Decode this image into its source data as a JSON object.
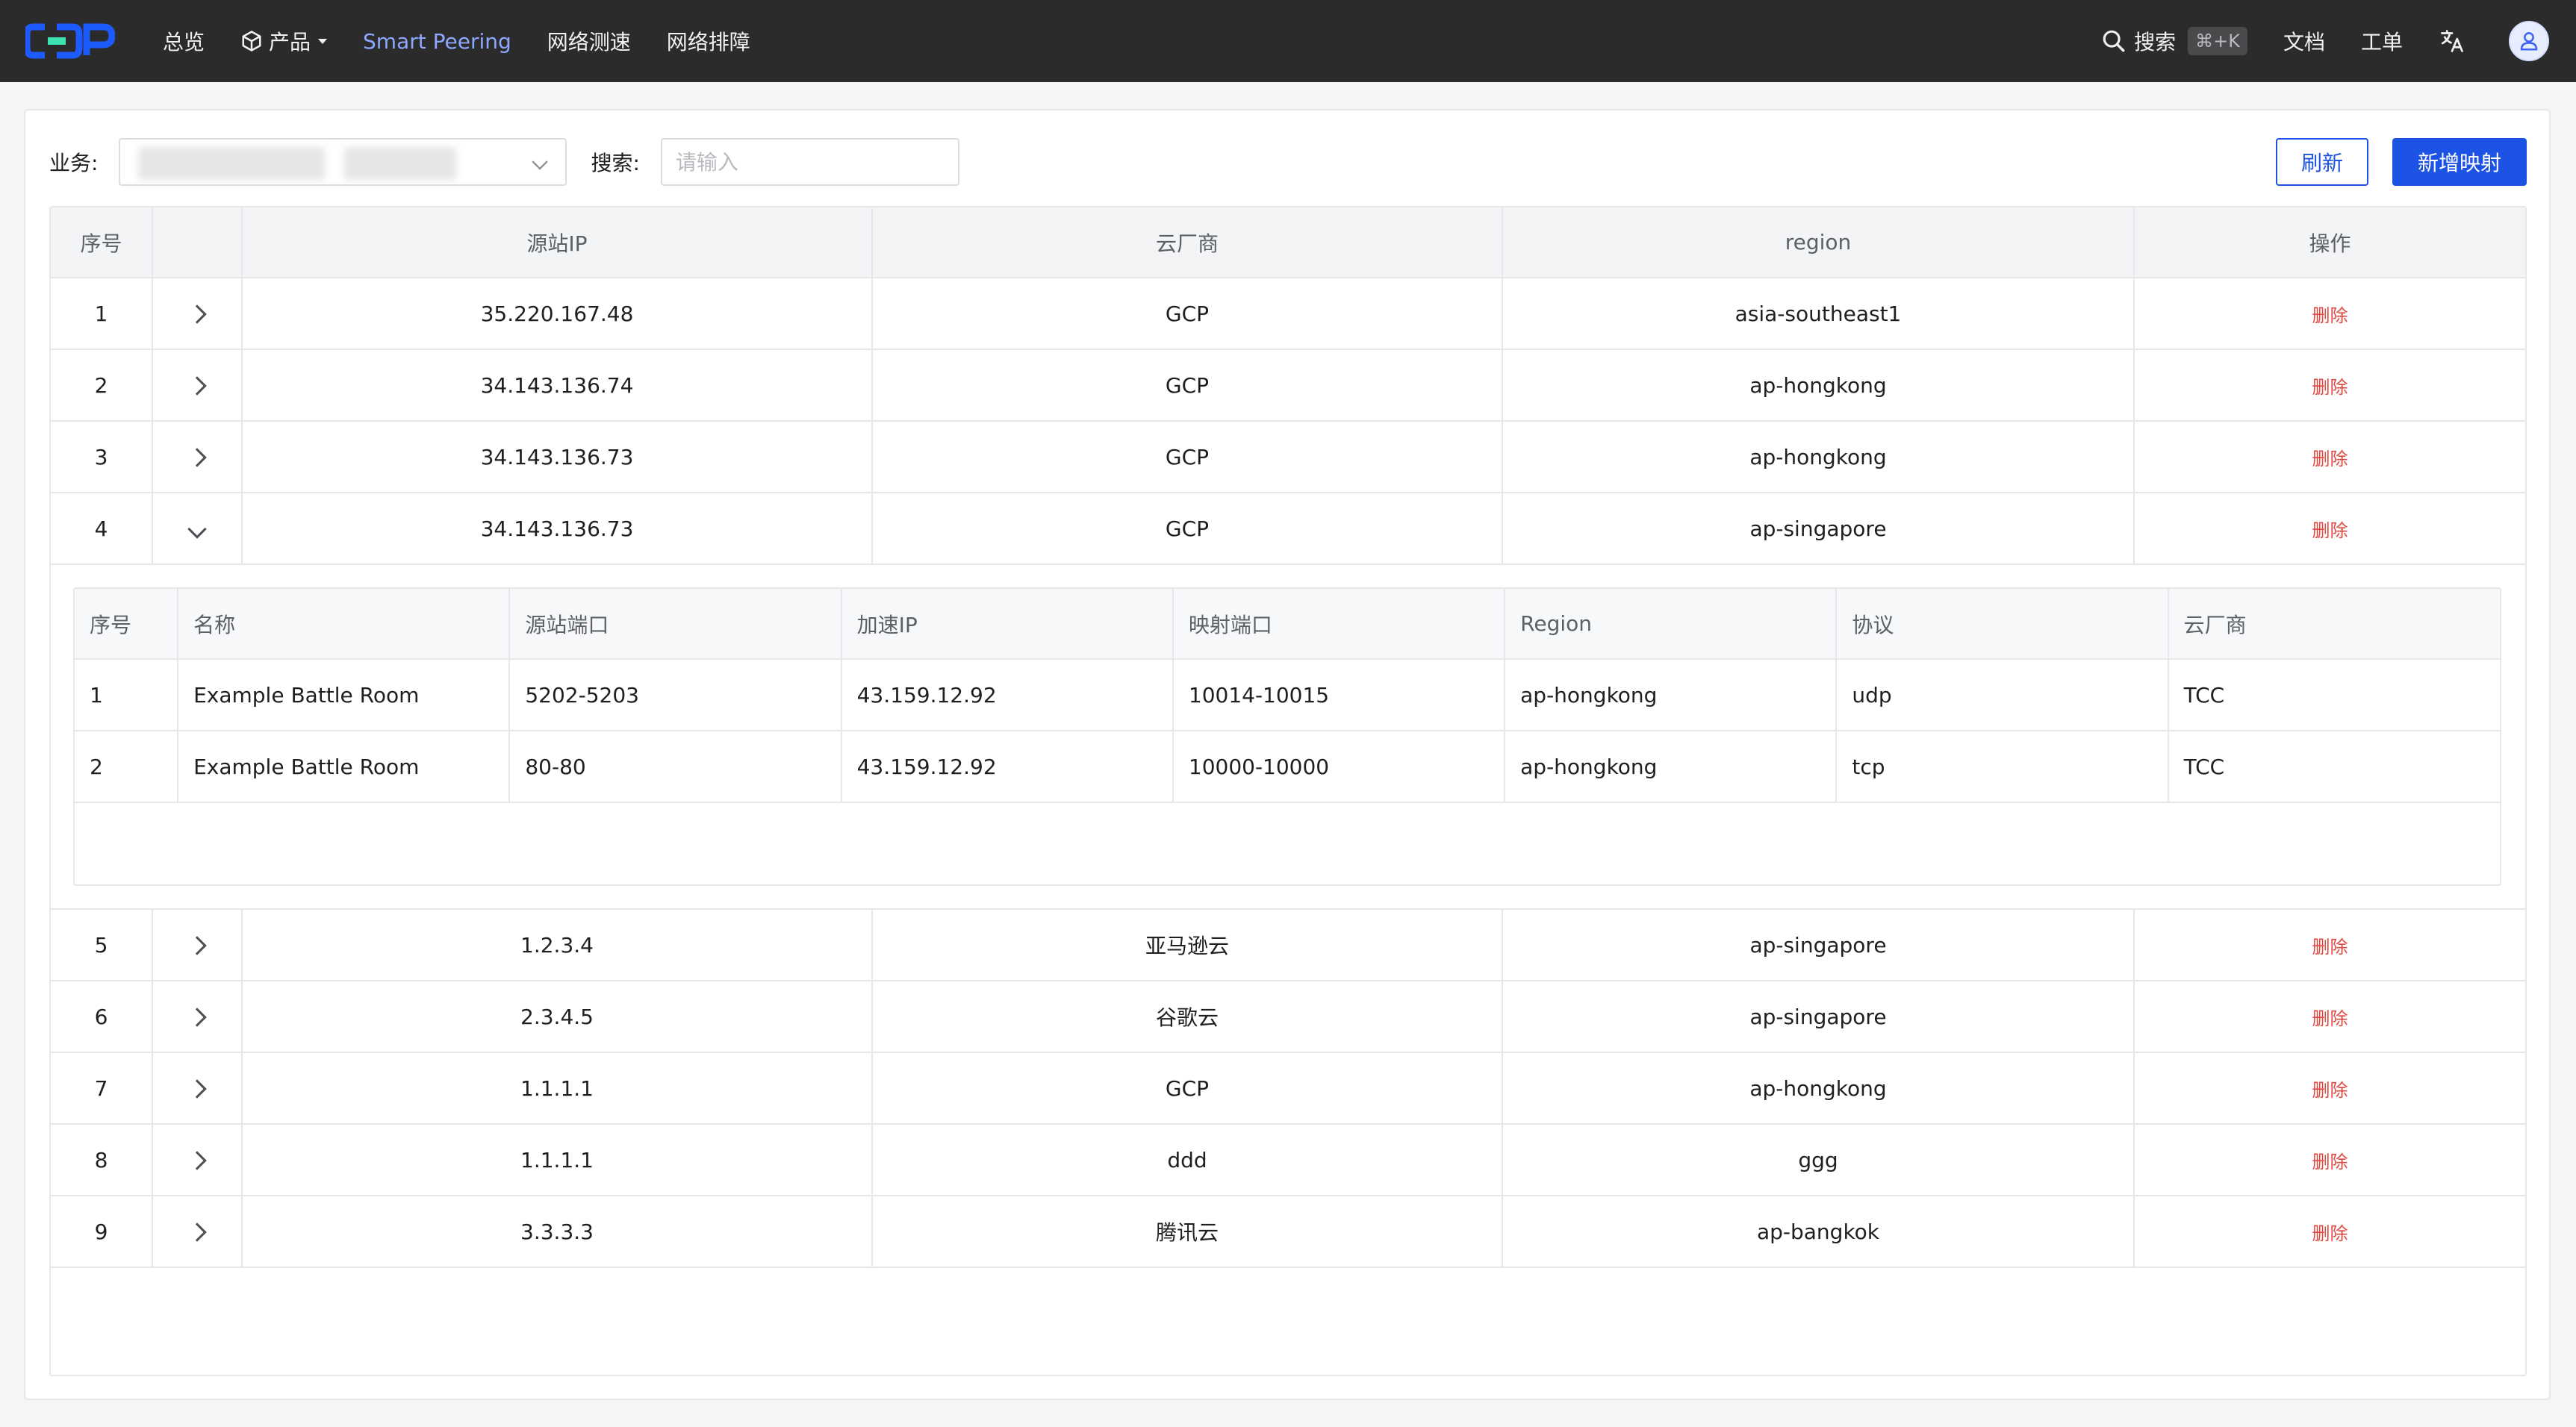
{
  "nav": {
    "items": [
      {
        "label": "总览"
      },
      {
        "label": "产品"
      },
      {
        "label": "Smart Peering"
      },
      {
        "label": "网络测速"
      },
      {
        "label": "网络排障"
      }
    ],
    "active_item": "Smart Peering",
    "search_label": "搜索",
    "search_shortcut": "⌘+K",
    "docs_label": "文档",
    "tickets_label": "工单"
  },
  "filters": {
    "business_label": "业务:",
    "search_label": "搜索:",
    "search_placeholder": "请输入"
  },
  "actions": {
    "refresh_label": "刷新",
    "add_label": "新增映射"
  },
  "table": {
    "columns": [
      "序号",
      "",
      "源站IP",
      "云厂商",
      "region",
      "操作"
    ],
    "delete_label": "删除",
    "rows": [
      {
        "index": "1",
        "ip": "35.220.167.48",
        "vendor": "GCP",
        "region": "asia-southeast1",
        "expanded": false
      },
      {
        "index": "2",
        "ip": "34.143.136.74",
        "vendor": "GCP",
        "region": "ap-hongkong",
        "expanded": false
      },
      {
        "index": "3",
        "ip": "34.143.136.73",
        "vendor": "GCP",
        "region": "ap-hongkong",
        "expanded": false
      },
      {
        "index": "4",
        "ip": "34.143.136.73",
        "vendor": "GCP",
        "region": "ap-singapore",
        "expanded": true
      },
      {
        "index": "5",
        "ip": "1.2.3.4",
        "vendor": "亚马逊云",
        "region": "ap-singapore",
        "expanded": false
      },
      {
        "index": "6",
        "ip": "2.3.4.5",
        "vendor": "谷歌云",
        "region": "ap-singapore",
        "expanded": false
      },
      {
        "index": "7",
        "ip": "1.1.1.1",
        "vendor": "GCP",
        "region": "ap-hongkong",
        "expanded": false
      },
      {
        "index": "8",
        "ip": "1.1.1.1",
        "vendor": "ddd",
        "region": "ggg",
        "expanded": false
      },
      {
        "index": "9",
        "ip": "3.3.3.3",
        "vendor": "腾讯云",
        "region": "ap-bangkok",
        "expanded": false
      }
    ]
  },
  "sub_table": {
    "columns": [
      "序号",
      "名称",
      "源站端口",
      "加速IP",
      "映射端口",
      "Region",
      "协议",
      "云厂商"
    ],
    "rows": [
      [
        "1",
        "Example Battle Room",
        "5202-5203",
        "43.159.12.92",
        "10014-10015",
        "ap-hongkong",
        "udp",
        "TCC"
      ],
      [
        "2",
        "Example Battle Room",
        "80-80",
        "43.159.12.92",
        "10000-10000",
        "ap-hongkong",
        "tcp",
        "TCC"
      ]
    ]
  },
  "colors": {
    "topbar_bg": "#2b2b2c",
    "accent": "#1d53e4",
    "active_nav": "#8ea7ff",
    "danger": "#e0483f"
  }
}
